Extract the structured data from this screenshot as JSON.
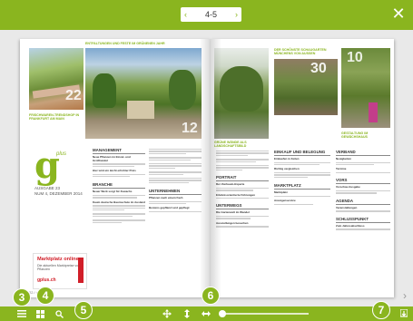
{
  "topbar": {
    "page_label": "4-5",
    "prev_symbol": "‹",
    "next_symbol": "›",
    "close_symbol": "✕"
  },
  "left_page": {
    "caption_top": "ENTFALTUNGEN UND FESTE IM GRÜNENEN JAHR",
    "caption_left": "FRISCHWAREN-TRENDSHOP IN FRANKFURT AM MAIN",
    "photo_num_1": "22",
    "photo_num_2": "12",
    "logo_plus": "plus",
    "issue_lines": [
      "AUSGABE 23",
      "NUM 4, DEZEMBER 2014"
    ],
    "sections": [
      {
        "title": "MANAGEMENT",
        "items": [
          "Neue Pflanzen im Einzel- und Großhandel",
          "Hier wird ein leicht erhöhter Preis"
        ]
      },
      {
        "title": "BRANCHE",
        "items": [
          "Neuer Werk sorgt für Zuwachs",
          "Kaum deutsche Baumschule im Ausland"
        ]
      },
      {
        "title": "Unternehmen",
        "items": [
          "Pflanzen nach einem Fach",
          "Bestens gepflanzt und gepflegt"
        ]
      }
    ],
    "ad": {
      "title": "Marktplatz online",
      "subtitle": "Die aktuellen Marktpreise von Pflanzen",
      "url": "gplus.ch"
    },
    "footer_label": "22 / 4"
  },
  "right_page": {
    "caption_right": "DER SCHÖNSTE SCHAUGARTEN MÜNCHENS VON AUSSEN",
    "caption_far": "GESTALTUNG IM GEWÄCHSHAUS",
    "caption_mid": "GRÜNE WÄNDE ALS LANDSCHAFTSBILD",
    "photo_num_3": "30",
    "photo_num_4": "10",
    "sections": [
      {
        "title": "PORTRAIT",
        "items": [
          "Der Zierbaum-Experte",
          "Erlebnisorientierte Führungen"
        ]
      },
      {
        "title": "UNTERWEGS",
        "items": [
          "Die Gartenwelt im Wandel",
          "Ausstellungen besuchen"
        ]
      },
      {
        "title": "EINKAUF UND BELEGUNG",
        "items": [
          "Einkaufen in Zeiten",
          "Richtig vergleichen"
        ]
      },
      {
        "title": "MARKTPLATZ",
        "items": [
          "Marktplatz",
          "Anzeigenservice"
        ]
      },
      {
        "title": "VERBAND",
        "items": [
          "Neuigkeiten",
          "Termine"
        ]
      },
      {
        "title": "VORS",
        "items": [
          "Vorschau Ausgabe"
        ]
      },
      {
        "title": "AGENDA",
        "items": [
          "Veranstaltungen"
        ]
      },
      {
        "title": "SCHLUSSPUNKT",
        "items": [
          "Zum Jahresabschluss"
        ]
      }
    ],
    "next_arrow": "›"
  },
  "callouts": [
    "3",
    "4",
    "5",
    "6",
    "7"
  ],
  "toolbar": {
    "icons": [
      "menu-icon",
      "grid-icon",
      "search-icon",
      "move-icon",
      "fit-height-icon",
      "fit-width-icon",
      "zoom-slider",
      "download-icon"
    ]
  }
}
